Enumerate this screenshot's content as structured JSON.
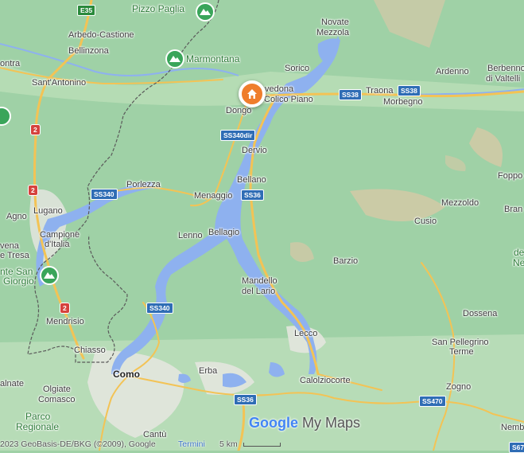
{
  "map": {
    "attribution": "2023 GeoBasis-DE/BKG (©2009), Google",
    "terms_link": "Termini",
    "scale_label": "5 km",
    "logo_google": "Google",
    "logo_mymaps": "My Maps",
    "home_marker": "home-marker"
  },
  "places": {
    "pizzo_paglia": "Pizzo Paglia",
    "arbedo": "Arbedo-Castione",
    "bellinzona": "Bellinzona",
    "marmontana": "Marmontana",
    "novate": "Novate",
    "mezzola": "Mezzola",
    "sorico": "Sorico",
    "ontra": "ontra",
    "sant_antonino": "Sant'Antonino",
    "gravedona": "vedona",
    "colico_piano": "Colico Piano",
    "ardenno": "Ardenno",
    "berbenno": "Berbenno",
    "di_valtelli": "di Valtelli",
    "traona": "Traona",
    "morbegno": "Morbegno",
    "dongo": "Dongo",
    "dervio": "Dervio",
    "porlezza": "Porlezza",
    "bellano": "Bellano",
    "menaggio": "Menaggio",
    "foppo": "Foppo",
    "lugano": "Lugano",
    "mezzoldo": "Mezzoldo",
    "branz": "Bran",
    "agno": "Agno",
    "cusio": "Cusio",
    "campione": "Campione",
    "ditalia": "d'Italia",
    "lenno": "Lenno",
    "bellagio": "Bellagio",
    "vena": "vena",
    "tresa": "e Tresa",
    "barzio": "Barzio",
    "monte_san": "nte San",
    "giorgio": "Giorgio",
    "de": "de",
    "ne": "Ne",
    "mandello": "Mandello",
    "del_lario": "del Lario",
    "mendrisio": "Mendrisio",
    "dossena": "Dossena",
    "lecco": "Lecco",
    "chiasso": "Chiasso",
    "san_pellegrino": "San Pellegrino",
    "terme": "Terme",
    "como": "Como",
    "erba": "Erba",
    "calolziocorte": "Calolziocorte",
    "balnate": "alnate",
    "olgiate": "Olgiate",
    "comasco": "Comasco",
    "zogno": "Zogno",
    "parco": "Parco",
    "regionale": "Regionale",
    "cantu": "Cantù",
    "nemb": "Nemb"
  },
  "roads": {
    "e35": "E35",
    "ss38a": "SS38",
    "ss38b": "SS38",
    "ss340dir": "SS340dir",
    "ss36a": "SS36",
    "ss340a": "SS340",
    "ss340b": "SS340",
    "ss36b": "SS36",
    "ss470": "SS470",
    "r2a": "2",
    "r2b": "2",
    "r2c": "2",
    "ss67": "S67"
  },
  "colors": {
    "land": "#9fd1a6",
    "water": "#8eb1ef",
    "road": "#f3c355",
    "urban": "#e6e6e0",
    "border": "#5a5a5a",
    "marker": "#ef7d2c",
    "mountain_icon": "#3aa55a"
  }
}
